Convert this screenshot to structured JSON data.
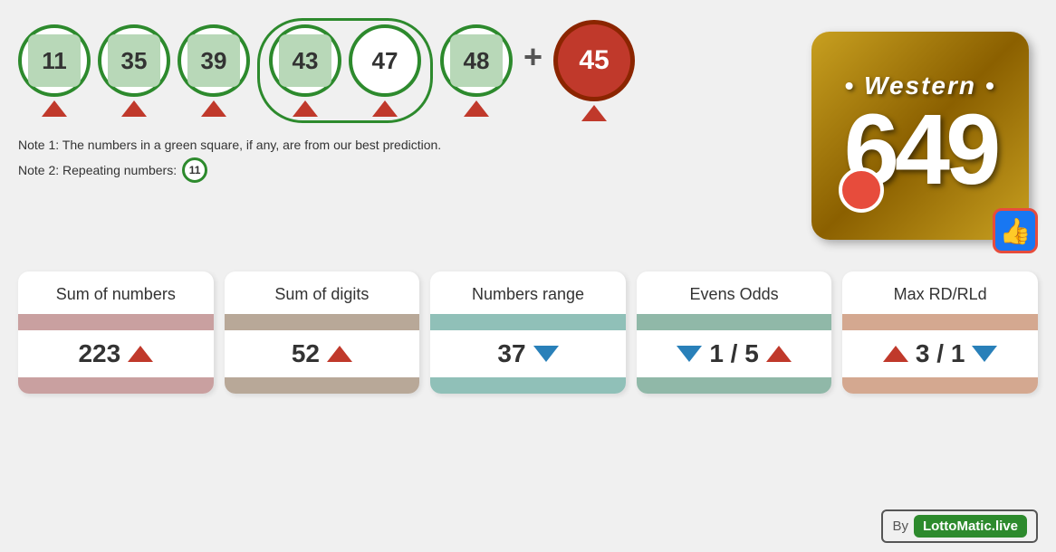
{
  "balls": [
    {
      "number": "11",
      "hasInner": true,
      "isBonus": false,
      "arrowDir": "up"
    },
    {
      "number": "35",
      "hasInner": true,
      "isBonus": false,
      "arrowDir": "up"
    },
    {
      "number": "39",
      "hasInner": true,
      "isBonus": false,
      "arrowDir": "up"
    },
    {
      "number": "43",
      "hasInner": true,
      "isBonus": false,
      "arrowDir": "up"
    },
    {
      "number": "47",
      "hasInner": false,
      "isBonus": false,
      "arrowDir": "up"
    },
    {
      "number": "48",
      "hasInner": true,
      "isBonus": false,
      "arrowDir": "up"
    }
  ],
  "bonus": {
    "number": "45",
    "arrowDir": "up"
  },
  "plusSign": "+",
  "notes": {
    "note1": "Note 1: The numbers in a green square, if any, are from our best prediction.",
    "note2": "Note 2: Repeating numbers:",
    "repeatingNumber": "11"
  },
  "logo": {
    "topText": "Western",
    "mainNumber": "649",
    "thumbsUp": "👍"
  },
  "stats": [
    {
      "title": "Sum of numbers",
      "value": "223",
      "arrowDir": "up",
      "colorClass": "card-pink"
    },
    {
      "title": "Sum of digits",
      "value": "52",
      "arrowDir": "up",
      "colorClass": "card-tan"
    },
    {
      "title": "Numbers range",
      "value": "37",
      "arrowDir": "down",
      "colorClass": "card-teal"
    },
    {
      "title": "Evens Odds",
      "value": "1 / 5",
      "arrowLeftDir": "down",
      "arrowRightDir": "up",
      "colorClass": "card-mint"
    },
    {
      "title": "Max RD/RLd",
      "value": "3 / 1",
      "arrowLeftDir": "up",
      "arrowRightDir": "down",
      "colorClass": "card-peach"
    }
  ],
  "footer": {
    "byText": "By",
    "brandText": "LottoMatic.live"
  }
}
